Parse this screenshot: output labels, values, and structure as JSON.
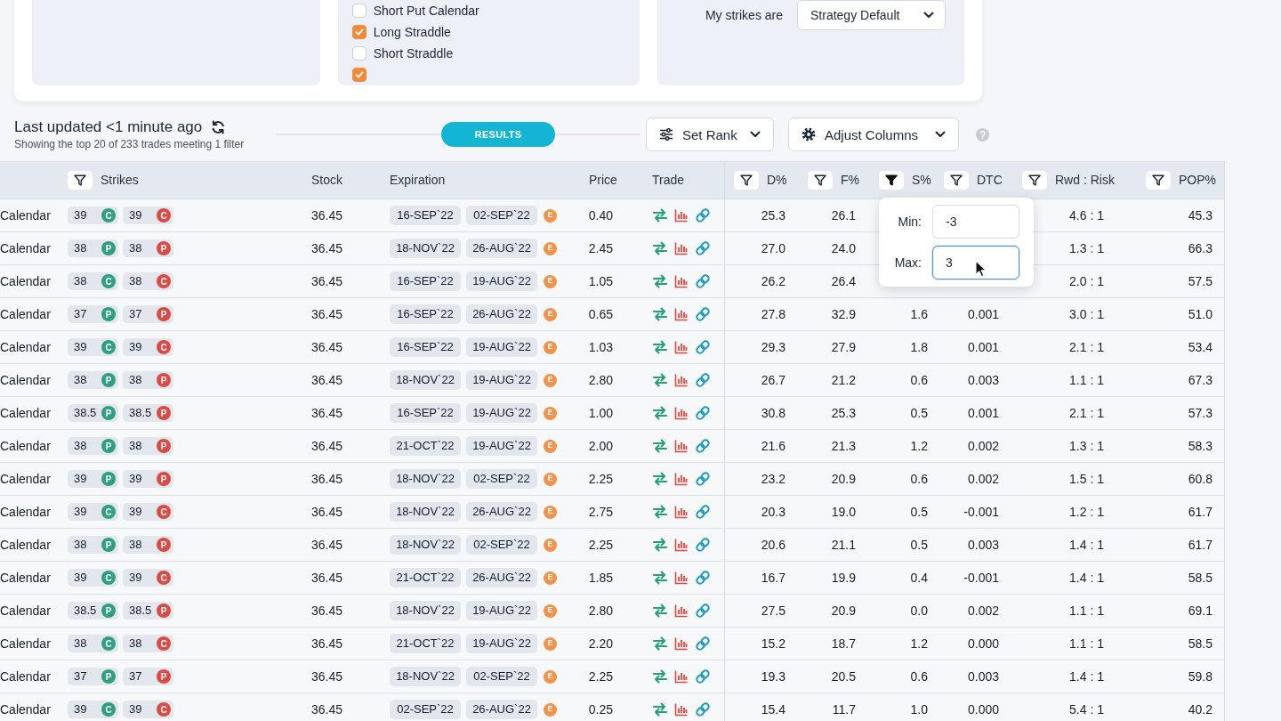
{
  "filters_panel": {
    "strategies": [
      {
        "label": "Short Put Calendar",
        "checked": false
      },
      {
        "label": "Long Straddle",
        "checked": true
      },
      {
        "label": "Short Straddle",
        "checked": false
      },
      {
        "checked": true
      }
    ],
    "strikes_label": "My strikes are",
    "strikes_select": "Strategy Default"
  },
  "results_header": {
    "title": "Last updated <1 minute ago",
    "subtitle": "Showing the top 20 of 233 trades meeting 1 filter",
    "results_label": "RESULTS",
    "rank_button": "Set Rank",
    "columns_button": "Adjust Columns"
  },
  "table": {
    "columns": [
      {
        "label": "Strikes",
        "filter_active": false
      },
      {
        "label": "Stock"
      },
      {
        "label": "Expiration"
      },
      {
        "label": "Price"
      },
      {
        "label": "Trade"
      },
      {
        "label": "D%",
        "filter_active": false
      },
      {
        "label": "F%",
        "filter_active": false
      },
      {
        "label": "S%",
        "filter_active": true
      },
      {
        "label": "DTC",
        "filter_active": false
      },
      {
        "label": "Rwd : Risk",
        "filter_active": false
      },
      {
        "label": "POP%",
        "filter_active": false
      }
    ],
    "rows": [
      {
        "strategy": "Calendar",
        "legs": [
          {
            "strike": "39",
            "type": "C",
            "color": "#2f9f7f"
          },
          {
            "strike": "39",
            "type": "C",
            "color": "#d94b45"
          }
        ],
        "stock": "36.45",
        "expirations": [
          "16-SEP`22",
          "02-SEP`22"
        ],
        "earnings": "E",
        "price": "0.40",
        "d_pct": "25.3",
        "f_pct": "26.1",
        "rwd_risk": "4.6 : 1",
        "pop_pct": "45.3"
      },
      {
        "strategy": "Calendar",
        "legs": [
          {
            "strike": "38",
            "type": "P",
            "color": "#2f9f7f"
          },
          {
            "strike": "38",
            "type": "P",
            "color": "#d94b45"
          }
        ],
        "stock": "36.45",
        "expirations": [
          "18-NOV`22",
          "26-AUG`22"
        ],
        "earnings": "E",
        "price": "2.45",
        "d_pct": "27.0",
        "f_pct": "24.0",
        "rwd_risk": "1.3 : 1",
        "pop_pct": "66.3"
      },
      {
        "strategy": "Calendar",
        "legs": [
          {
            "strike": "38",
            "type": "C",
            "color": "#2f9f7f"
          },
          {
            "strike": "38",
            "type": "C",
            "color": "#d94b45"
          }
        ],
        "stock": "36.45",
        "expirations": [
          "16-SEP`22",
          "19-AUG`22"
        ],
        "earnings": "E",
        "price": "1.05",
        "d_pct": "26.2",
        "f_pct": "26.4",
        "rwd_risk": "2.0 : 1",
        "pop_pct": "57.5"
      },
      {
        "strategy": "Calendar",
        "legs": [
          {
            "strike": "37",
            "type": "P",
            "color": "#2f9f7f"
          },
          {
            "strike": "37",
            "type": "P",
            "color": "#d94b45"
          }
        ],
        "stock": "36.45",
        "expirations": [
          "16-SEP`22",
          "26-AUG`22"
        ],
        "earnings": "E",
        "price": "0.65",
        "d_pct": "27.8",
        "f_pct": "32.9",
        "s_pct": "1.6",
        "dtc": "0.001",
        "rwd_risk": "3.0 : 1",
        "pop_pct": "51.0"
      },
      {
        "strategy": "Calendar",
        "legs": [
          {
            "strike": "39",
            "type": "C",
            "color": "#2f9f7f"
          },
          {
            "strike": "39",
            "type": "C",
            "color": "#d94b45"
          }
        ],
        "stock": "36.45",
        "expirations": [
          "16-SEP`22",
          "19-AUG`22"
        ],
        "earnings": "E",
        "price": "1.03",
        "d_pct": "29.3",
        "f_pct": "27.9",
        "s_pct": "1.8",
        "dtc": "0.001",
        "rwd_risk": "2.1 : 1",
        "pop_pct": "53.4"
      },
      {
        "strategy": "Calendar",
        "legs": [
          {
            "strike": "38",
            "type": "P",
            "color": "#2f9f7f"
          },
          {
            "strike": "38",
            "type": "P",
            "color": "#d94b45"
          }
        ],
        "stock": "36.45",
        "expirations": [
          "18-NOV`22",
          "19-AUG`22"
        ],
        "earnings": "E",
        "price": "2.80",
        "d_pct": "26.7",
        "f_pct": "21.2",
        "s_pct": "0.6",
        "dtc": "0.003",
        "rwd_risk": "1.1 : 1",
        "pop_pct": "67.3"
      },
      {
        "strategy": "Calendar",
        "legs": [
          {
            "strike": "38.5",
            "type": "P",
            "color": "#2f9f7f"
          },
          {
            "strike": "38.5",
            "type": "P",
            "color": "#d94b45"
          }
        ],
        "stock": "36.45",
        "expirations": [
          "16-SEP`22",
          "19-AUG`22"
        ],
        "earnings": "E",
        "price": "1.00",
        "d_pct": "30.8",
        "f_pct": "25.3",
        "s_pct": "0.5",
        "dtc": "0.001",
        "rwd_risk": "2.1 : 1",
        "pop_pct": "57.3"
      },
      {
        "strategy": "Calendar",
        "legs": [
          {
            "strike": "38",
            "type": "P",
            "color": "#2f9f7f"
          },
          {
            "strike": "38",
            "type": "P",
            "color": "#d94b45"
          }
        ],
        "stock": "36.45",
        "expirations": [
          "21-OCT`22",
          "19-AUG`22"
        ],
        "earnings": "E",
        "price": "2.00",
        "d_pct": "21.6",
        "f_pct": "21.3",
        "s_pct": "1.2",
        "dtc": "0.002",
        "rwd_risk": "1.3 : 1",
        "pop_pct": "58.3"
      },
      {
        "strategy": "Calendar",
        "legs": [
          {
            "strike": "39",
            "type": "P",
            "color": "#2f9f7f"
          },
          {
            "strike": "39",
            "type": "P",
            "color": "#d94b45"
          }
        ],
        "stock": "36.45",
        "expirations": [
          "18-NOV`22",
          "02-SEP`22"
        ],
        "earnings": "E",
        "price": "2.25",
        "d_pct": "23.2",
        "f_pct": "20.9",
        "s_pct": "0.6",
        "dtc": "0.002",
        "rwd_risk": "1.5 : 1",
        "pop_pct": "60.8"
      },
      {
        "strategy": "Calendar",
        "legs": [
          {
            "strike": "39",
            "type": "C",
            "color": "#2f9f7f"
          },
          {
            "strike": "39",
            "type": "C",
            "color": "#d94b45"
          }
        ],
        "stock": "36.45",
        "expirations": [
          "18-NOV`22",
          "26-AUG`22"
        ],
        "earnings": "E",
        "price": "2.75",
        "d_pct": "20.3",
        "f_pct": "19.0",
        "s_pct": "0.5",
        "dtc": "-0.001",
        "rwd_risk": "1.2 : 1",
        "pop_pct": "61.7"
      },
      {
        "strategy": "Calendar",
        "legs": [
          {
            "strike": "38",
            "type": "P",
            "color": "#2f9f7f"
          },
          {
            "strike": "38",
            "type": "P",
            "color": "#d94b45"
          }
        ],
        "stock": "36.45",
        "expirations": [
          "18-NOV`22",
          "02-SEP`22"
        ],
        "earnings": "E",
        "price": "2.25",
        "d_pct": "20.6",
        "f_pct": "21.1",
        "s_pct": "0.5",
        "dtc": "0.003",
        "rwd_risk": "1.4 : 1",
        "pop_pct": "61.7"
      },
      {
        "strategy": "Calendar",
        "legs": [
          {
            "strike": "39",
            "type": "C",
            "color": "#2f9f7f"
          },
          {
            "strike": "39",
            "type": "C",
            "color": "#d94b45"
          }
        ],
        "stock": "36.45",
        "expirations": [
          "21-OCT`22",
          "26-AUG`22"
        ],
        "earnings": "E",
        "price": "1.85",
        "d_pct": "16.7",
        "f_pct": "19.9",
        "s_pct": "0.4",
        "dtc": "-0.001",
        "rwd_risk": "1.4 : 1",
        "pop_pct": "58.5"
      },
      {
        "strategy": "Calendar",
        "legs": [
          {
            "strike": "38.5",
            "type": "P",
            "color": "#2f9f7f"
          },
          {
            "strike": "38.5",
            "type": "P",
            "color": "#d94b45"
          }
        ],
        "stock": "36.45",
        "expirations": [
          "18-NOV`22",
          "19-AUG`22"
        ],
        "earnings": "E",
        "price": "2.80",
        "d_pct": "27.5",
        "f_pct": "20.9",
        "s_pct": "0.0",
        "dtc": "0.002",
        "rwd_risk": "1.1 : 1",
        "pop_pct": "69.1"
      },
      {
        "strategy": "Calendar",
        "legs": [
          {
            "strike": "38",
            "type": "C",
            "color": "#2f9f7f"
          },
          {
            "strike": "38",
            "type": "C",
            "color": "#d94b45"
          }
        ],
        "stock": "36.45",
        "expirations": [
          "21-OCT`22",
          "19-AUG`22"
        ],
        "earnings": "E",
        "price": "2.20",
        "d_pct": "15.2",
        "f_pct": "18.7",
        "s_pct": "1.2",
        "dtc": "0.000",
        "rwd_risk": "1.1 : 1",
        "pop_pct": "58.5"
      },
      {
        "strategy": "Calendar",
        "legs": [
          {
            "strike": "37",
            "type": "P",
            "color": "#2f9f7f"
          },
          {
            "strike": "37",
            "type": "P",
            "color": "#d94b45"
          }
        ],
        "stock": "36.45",
        "expirations": [
          "18-NOV`22",
          "02-SEP`22"
        ],
        "earnings": "E",
        "price": "2.25",
        "d_pct": "19.3",
        "f_pct": "20.5",
        "s_pct": "0.6",
        "dtc": "0.003",
        "rwd_risk": "1.4 : 1",
        "pop_pct": "59.8"
      },
      {
        "strategy": "Calendar",
        "legs": [
          {
            "strike": "39",
            "type": "C",
            "color": "#2f9f7f"
          },
          {
            "strike": "39",
            "type": "C",
            "color": "#d94b45"
          }
        ],
        "stock": "36.45",
        "expirations": [
          "02-SEP`22",
          "26-AUG`22"
        ],
        "earnings": "E",
        "price": "0.25",
        "d_pct": "15.4",
        "f_pct": "11.7",
        "s_pct": "1.0",
        "dtc": "0.000",
        "rwd_risk": "5.4 : 1",
        "pop_pct": "40.2"
      }
    ]
  },
  "range_filter": {
    "fields": [
      {
        "label": "Min:",
        "value": "-3",
        "focused": false
      },
      {
        "label": "Max:",
        "value": "3",
        "focused": true
      }
    ]
  }
}
